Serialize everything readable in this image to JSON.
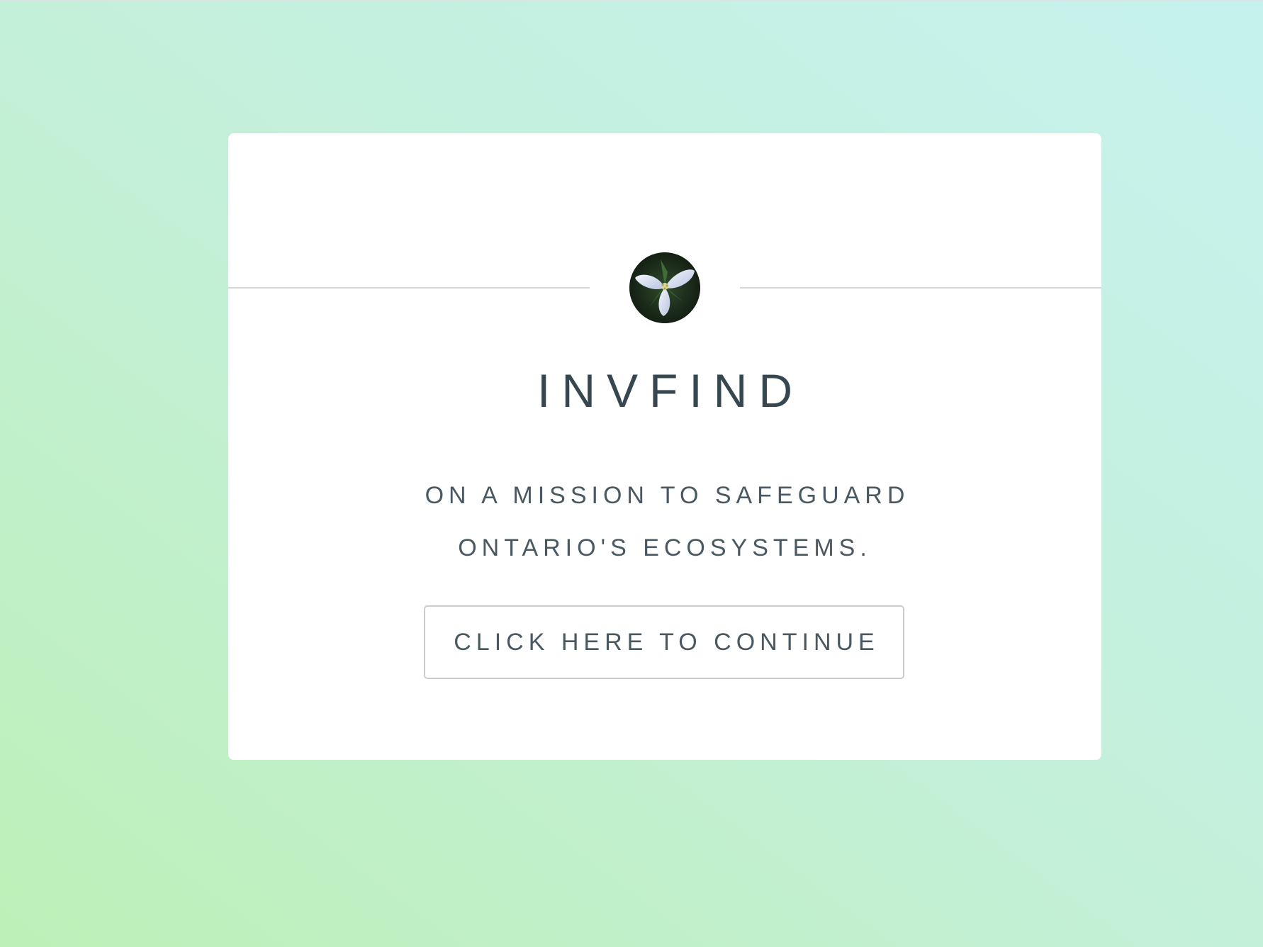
{
  "hero": {
    "logo_icon": "trillium-flower-icon",
    "title": "INVFIND",
    "tagline": "ON A MISSION TO SAFEGUARD ONTARIO'S ECOSYSTEMS.",
    "cta_label": "CLICK HERE TO CONTINUE"
  },
  "colors": {
    "background_start": "#bdf0b8",
    "background_end": "#c6f2ee",
    "card": "#ffffff",
    "text": "#37474f",
    "border": "#c9cdcd"
  }
}
